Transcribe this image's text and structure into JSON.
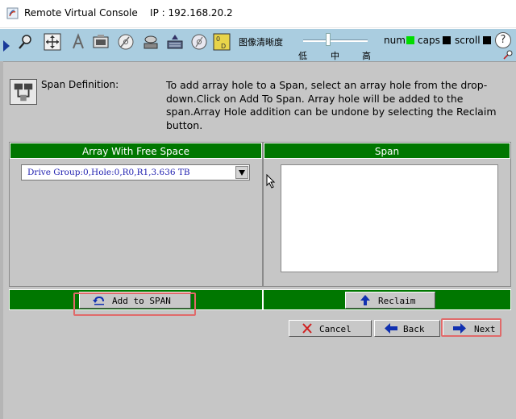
{
  "window": {
    "title": "Remote Virtual Console    IP : 192.168.20.2"
  },
  "toolbar": {
    "icons": [
      "pointer-icon",
      "move-icon",
      "font-icon",
      "monitor-icon",
      "disc-icon",
      "drive-icon",
      "keyboard-icon",
      "cd-icon",
      "record-icon"
    ],
    "quality_label": "图像清晰度",
    "slider_value": 0.38,
    "slider_ticks": [
      "低",
      "中",
      "高"
    ],
    "indicators": [
      {
        "label": "num",
        "color": "#00dd00"
      },
      {
        "label": "caps",
        "color": "#000000"
      },
      {
        "label": "scroll",
        "color": "#000000"
      }
    ],
    "help_label": "?"
  },
  "page": {
    "section_label": "Span Definition:",
    "instructions": "To add array hole to a Span, select an array hole from the drop-down.Click on Add To Span. Array hole will be added to the span.Array Hole addition can be undone by selecting the Reclaim button."
  },
  "left_panel": {
    "header": "Array With Free Space",
    "selected_option": "Drive Group:0,Hole:0,R0,R1,3.636 TB",
    "add_button_label": "Add to SPAN"
  },
  "right_panel": {
    "header": "Span",
    "items": [],
    "reclaim_button_label": "Reclaim"
  },
  "footer": {
    "cancel_label": "Cancel",
    "back_label": "Back",
    "next_label": "Next"
  },
  "colors": {
    "accent_green": "#007700",
    "toolbar_blue": "#aacde0",
    "panel_gray": "#c6c6c6",
    "highlight_red": "#e06a6a"
  }
}
